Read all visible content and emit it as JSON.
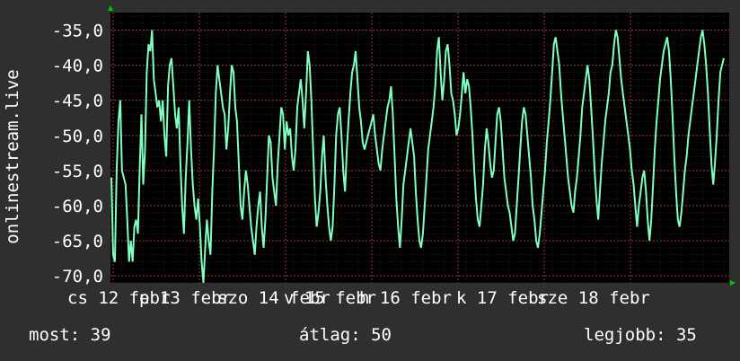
{
  "chart_data": {
    "type": "line",
    "ylabel": "onlinestream.live",
    "ylim": [
      -71,
      -32.5
    ],
    "y_ticks": [
      -70.0,
      -65.0,
      -60.0,
      -55.0,
      -50.0,
      -45.0,
      -40.0,
      -35.0
    ],
    "y_tick_labels": [
      "-70,0",
      "-65,0",
      "-60,0",
      "-55,0",
      "-50,0",
      "-45,0",
      "-40,0",
      "-35,0"
    ],
    "x_tick_labels": [
      "cs 12 febr",
      "p 13 febr",
      "szo 14 febr",
      "v 15 febr",
      "h 16 febr",
      "k 17 febr",
      "sze 18 febr"
    ],
    "grid": true,
    "series": [
      {
        "color": "#7fffc0",
        "values": [
          -56,
          -67,
          -68,
          -55,
          -48,
          -45,
          -55,
          -56,
          -57,
          -62,
          -68,
          -65,
          -68,
          -63,
          -62,
          -64,
          -55,
          -47,
          -57,
          -52,
          -41,
          -37,
          -38,
          -35,
          -42,
          -44,
          -46,
          -45,
          -48,
          -45,
          -50,
          -53,
          -43,
          -40,
          -39,
          -43,
          -47,
          -49,
          -46,
          -54,
          -60,
          -64,
          -56,
          -51,
          -45,
          -52,
          -57,
          -60,
          -62,
          -59,
          -63,
          -68,
          -71,
          -66,
          -62,
          -65,
          -67,
          -58,
          -52,
          -44,
          -40,
          -42,
          -44,
          -46,
          -47,
          -52,
          -49,
          -44,
          -40,
          -41,
          -46,
          -48,
          -54,
          -60,
          -62,
          -58,
          -55,
          -57,
          -60,
          -63,
          -65,
          -67,
          -63,
          -60,
          -58,
          -63,
          -66,
          -62,
          -56,
          -50,
          -51,
          -56,
          -58,
          -60,
          -54,
          -50,
          -46,
          -47,
          -52,
          -48,
          -50,
          -49,
          -53,
          -55,
          -52,
          -46,
          -44,
          -42,
          -45,
          -49,
          -44,
          -38,
          -40,
          -45,
          -52,
          -59,
          -63,
          -61,
          -58,
          -53,
          -50,
          -56,
          -60,
          -63,
          -65,
          -63,
          -57,
          -50,
          -47,
          -46,
          -50,
          -55,
          -58,
          -52,
          -48,
          -44,
          -41,
          -40,
          -38,
          -42,
          -46,
          -48,
          -51,
          -52,
          -51,
          -50,
          -49,
          -48,
          -47,
          -50,
          -52,
          -54,
          -55,
          -52,
          -50,
          -48,
          -46,
          -45,
          -43,
          -47,
          -53,
          -59,
          -63,
          -66,
          -62,
          -57,
          -55,
          -53,
          -51,
          -49,
          -51,
          -53,
          -58,
          -62,
          -65,
          -66,
          -64,
          -60,
          -56,
          -52,
          -50,
          -48,
          -46,
          -43,
          -38,
          -36,
          -41,
          -45,
          -42,
          -38,
          -37,
          -40,
          -44,
          -45,
          -47,
          -50,
          -49,
          -47,
          -44,
          -41,
          -44,
          -42,
          -43,
          -46,
          -50,
          -55,
          -59,
          -62,
          -63,
          -60,
          -57,
          -52,
          -49,
          -51,
          -54,
          -56,
          -55,
          -51,
          -47,
          -46,
          -48,
          -52,
          -56,
          -58,
          -60,
          -61,
          -63,
          -65,
          -64,
          -60,
          -56,
          -52,
          -48,
          -46,
          -47,
          -50,
          -53,
          -56,
          -60,
          -62,
          -65,
          -66,
          -64,
          -61,
          -58,
          -55,
          -51,
          -48,
          -45,
          -41,
          -37,
          -36,
          -38,
          -40,
          -44,
          -47,
          -50,
          -53,
          -56,
          -58,
          -60,
          -61,
          -58,
          -56,
          -53,
          -50,
          -46,
          -44,
          -42,
          -40,
          -42,
          -46,
          -50,
          -55,
          -59,
          -62,
          -58,
          -54,
          -51,
          -48,
          -46,
          -44,
          -41,
          -40,
          -37,
          -35,
          -36,
          -39,
          -42,
          -44,
          -46,
          -48,
          -50,
          -52,
          -55,
          -57,
          -60,
          -63,
          -60,
          -58,
          -56,
          -55,
          -58,
          -62,
          -65,
          -62,
          -57,
          -52,
          -48,
          -45,
          -42,
          -40,
          -38,
          -37,
          -36,
          -38,
          -42,
          -47,
          -53,
          -58,
          -62,
          -63,
          -61,
          -58,
          -55,
          -53,
          -50,
          -48,
          -46,
          -44,
          -42,
          -40,
          -38,
          -36,
          -35,
          -37,
          -40,
          -44,
          -49,
          -54,
          -57,
          -54,
          -50,
          -45,
          -41,
          -40,
          -39
        ]
      }
    ]
  },
  "stats": {
    "current": "most: 39",
    "average": "átlag: 50",
    "max": "legjobb: 35"
  },
  "colors": {
    "background": "#2f2f2f",
    "plot_background": "#000000",
    "grid": "#5a2a2a",
    "line": "#7fffc0",
    "axis_arrow": "#00cc00",
    "text": "#ffffff"
  }
}
